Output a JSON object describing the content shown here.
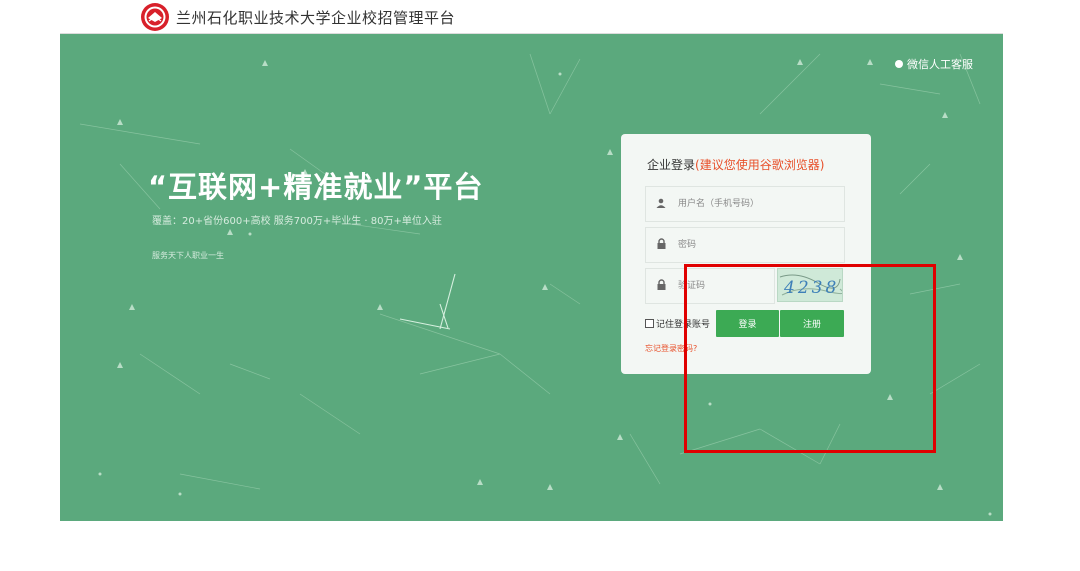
{
  "header": {
    "site_title": "兰州石化职业技术大学企业校招管理平台"
  },
  "support": {
    "label": "微信人工客服"
  },
  "hero": {
    "slogan": "“互联网+精准就业”平台",
    "stats": "覆盖：20+省份600+高校   服务700万+毕业生 · 80万+单位入驻",
    "motto": "服务天下人职业一生"
  },
  "login": {
    "title": "企业登录",
    "title_hint": "(建议您使用谷歌浏览器)",
    "username_placeholder": "用户名（手机号码）",
    "password_placeholder": "密码",
    "captcha_placeholder": "验证码",
    "captcha_text": "4238",
    "remember_label": "记住登录账号",
    "login_button": "登录",
    "register_button": "注册",
    "forgot_link": "忘记登录密码?"
  },
  "colors": {
    "hero_bg": "#5ba97d",
    "button_green": "#3caa54",
    "hint_orange": "#e8502a",
    "highlight_red": "#e00000"
  },
  "icons": {
    "logo": "school-emblem-icon",
    "support": "wechat-support-icon",
    "user": "user-icon",
    "password": "lock-icon",
    "captcha": "lock-icon"
  }
}
